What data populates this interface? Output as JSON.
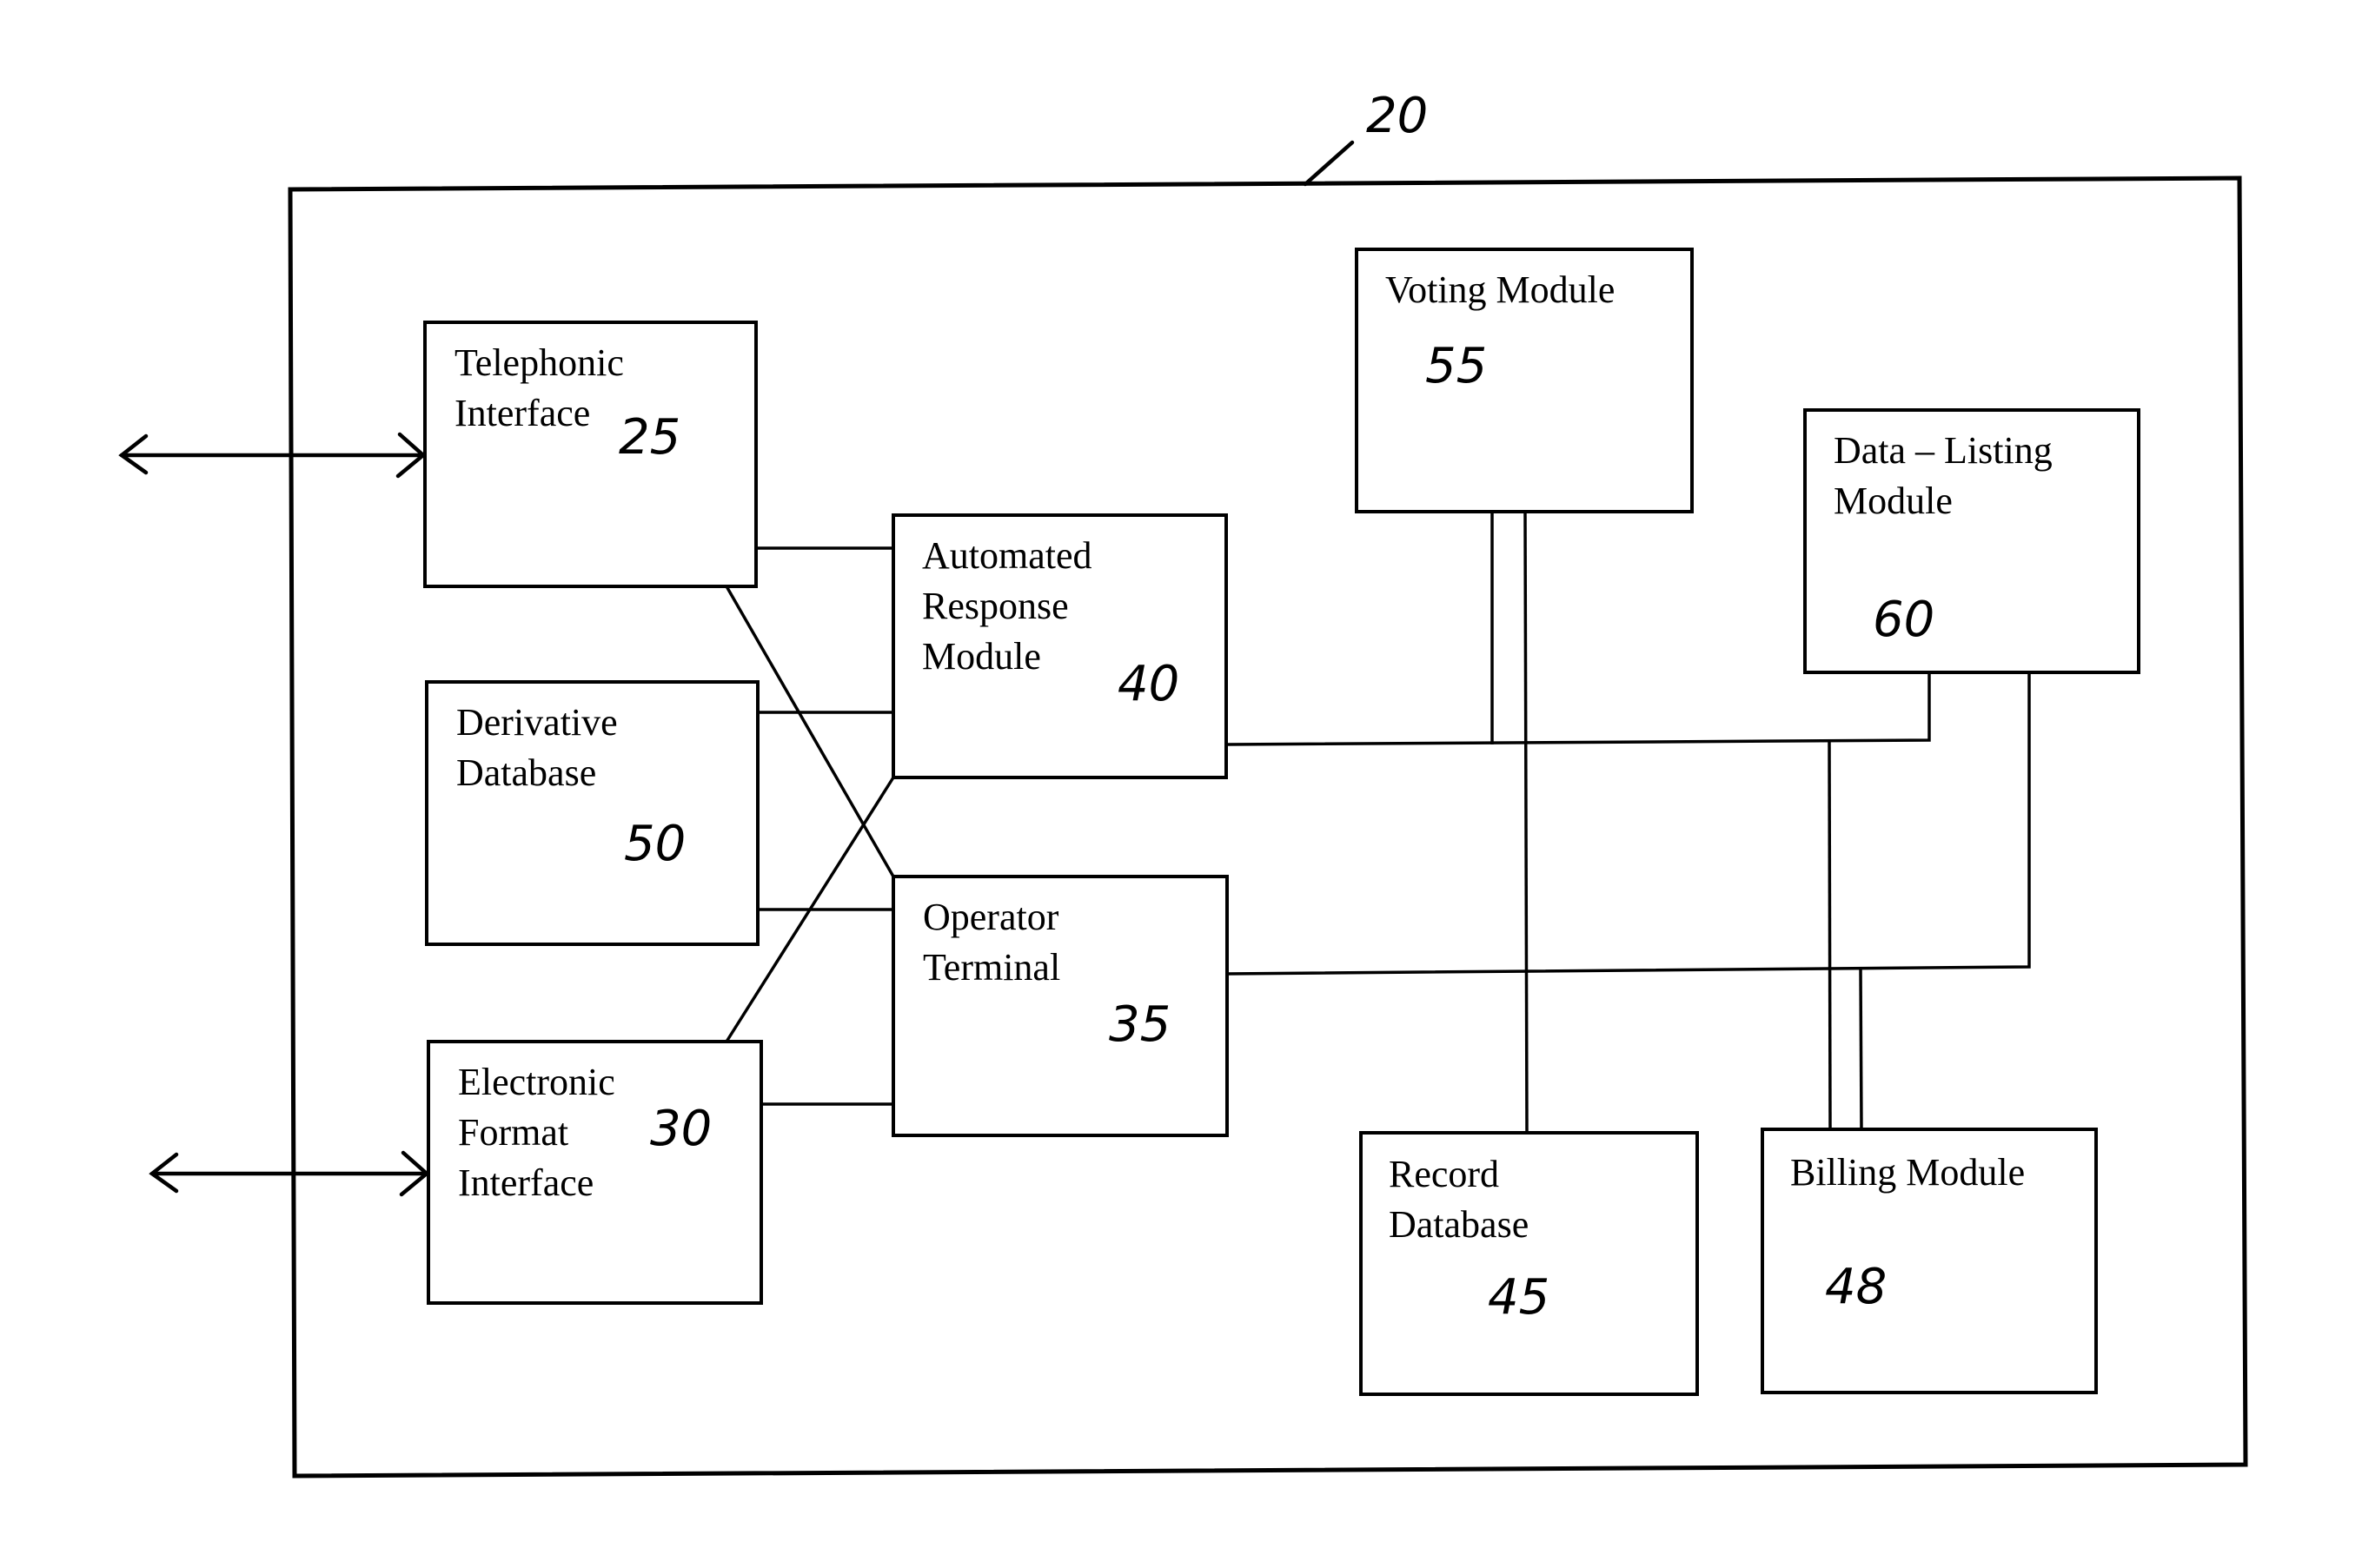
{
  "figure": {
    "system_ref": "20",
    "modules": [
      {
        "id": "telephonic",
        "lines": [
          "Telephonic",
          "Interface"
        ],
        "ref": "25"
      },
      {
        "id": "derivative",
        "lines": [
          "Derivative",
          "Database"
        ],
        "ref": "50"
      },
      {
        "id": "electronic",
        "lines": [
          "Electronic",
          "Format",
          "Interface"
        ],
        "ref": "30"
      },
      {
        "id": "automated",
        "lines": [
          "Automated",
          "Response",
          "Module"
        ],
        "ref": "40"
      },
      {
        "id": "operator",
        "lines": [
          "Operator",
          "Terminal"
        ],
        "ref": "35"
      },
      {
        "id": "voting",
        "lines": [
          "Voting Module"
        ],
        "ref": "55"
      },
      {
        "id": "datalisting",
        "lines": [
          "Data – Listing",
          "Module"
        ],
        "ref": "60"
      },
      {
        "id": "record",
        "lines": [
          "Record",
          "Database"
        ],
        "ref": "45"
      },
      {
        "id": "billing",
        "lines": [
          "Billing Module"
        ],
        "ref": "48"
      }
    ],
    "connections": [
      [
        "telephonic",
        "automated"
      ],
      [
        "telephonic",
        "operator"
      ],
      [
        "derivative",
        "automated"
      ],
      [
        "derivative",
        "operator"
      ],
      [
        "electronic",
        "automated"
      ],
      [
        "electronic",
        "operator"
      ],
      [
        "automated",
        "voting"
      ],
      [
        "automated",
        "datalisting"
      ],
      [
        "automated",
        "billing"
      ],
      [
        "voting",
        "record"
      ],
      [
        "operator",
        "datalisting"
      ],
      [
        "operator",
        "billing"
      ]
    ],
    "external_links": [
      "telephonic",
      "electronic"
    ]
  }
}
